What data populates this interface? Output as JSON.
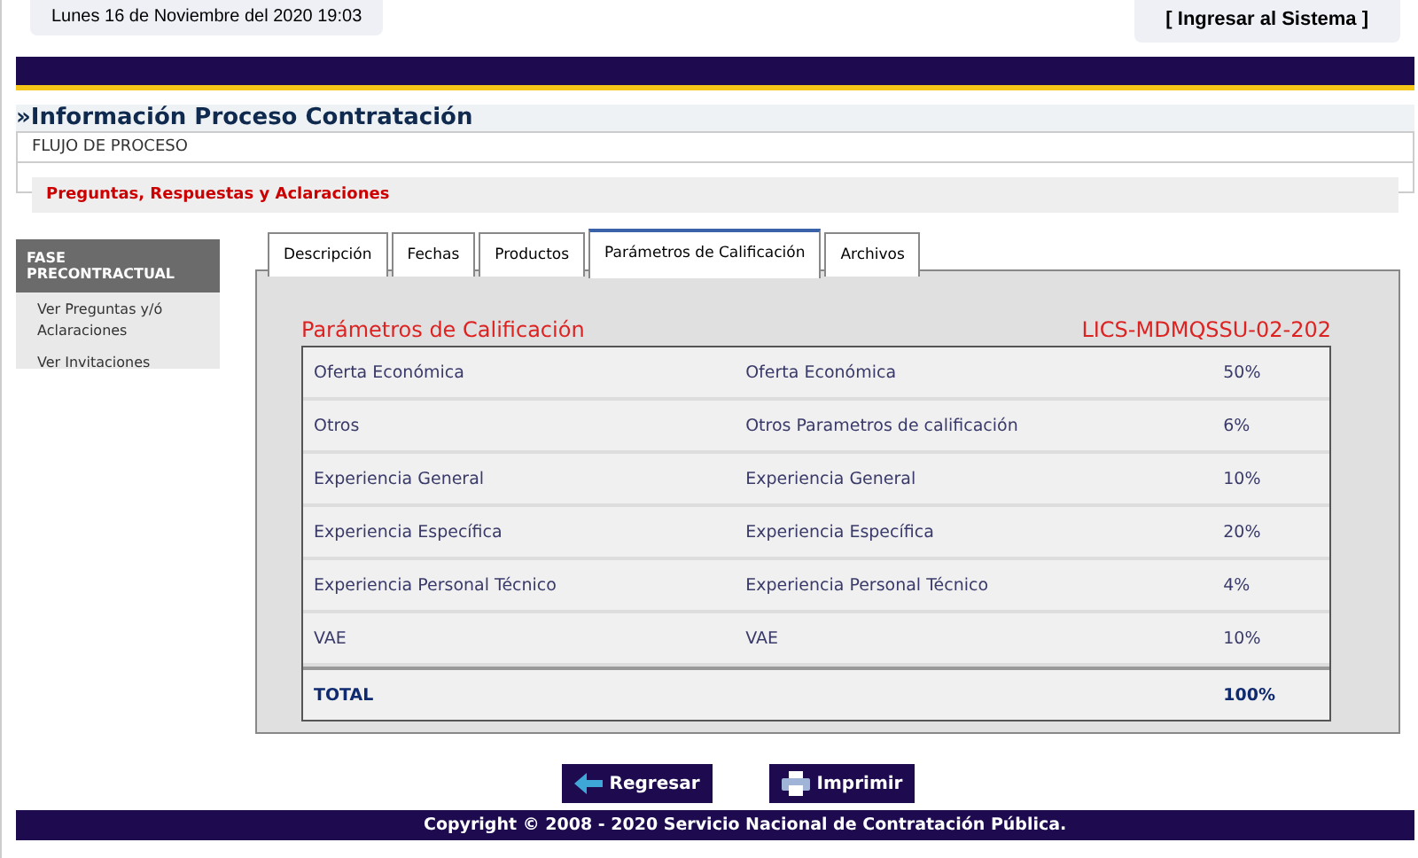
{
  "header": {
    "date": "Lunes 16 de Noviembre del 2020 19:03",
    "login_link": "[ Ingresar al Sistema ]"
  },
  "page_title": "»Información Proceso Contratación",
  "flow": {
    "label": "FLUJO DE PROCESO",
    "section": "Preguntas, Respuestas y Aclaraciones"
  },
  "sidebar": {
    "header": "FASE PRECONTRACTUAL",
    "items": [
      "Ver Preguntas y/ó Aclaraciones",
      "Ver Invitaciones"
    ]
  },
  "tabs": [
    {
      "label": "Descripción",
      "selected": false
    },
    {
      "label": "Fechas",
      "selected": false
    },
    {
      "label": "Productos",
      "selected": false
    },
    {
      "label": "Parámetros de Calificación",
      "selected": true
    },
    {
      "label": "Archivos",
      "selected": false
    }
  ],
  "panel": {
    "title": "Parámetros de Calificación",
    "code": "LICS-MDMQSSU-02-202"
  },
  "table": {
    "rows": [
      [
        "Oferta Económica",
        "Oferta Económica",
        "50%"
      ],
      [
        "Otros",
        "Otros Parametros de calificación",
        "6%"
      ],
      [
        "Experiencia General",
        "Experiencia General",
        "10%"
      ],
      [
        "Experiencia Específica",
        "Experiencia Específica",
        "20%"
      ],
      [
        "Experiencia Personal Técnico",
        "Experiencia Personal Técnico",
        "4%"
      ],
      [
        "VAE",
        "VAE",
        "10%"
      ]
    ],
    "total": {
      "label": "TOTAL",
      "value": "100%"
    }
  },
  "buttons": [
    {
      "kind": "back",
      "label": "Regresar"
    },
    {
      "kind": "print",
      "label": "Imprimir"
    }
  ],
  "footer": "Copyright © 2008 - 2020 Servicio Nacional de Contratación Pública."
}
